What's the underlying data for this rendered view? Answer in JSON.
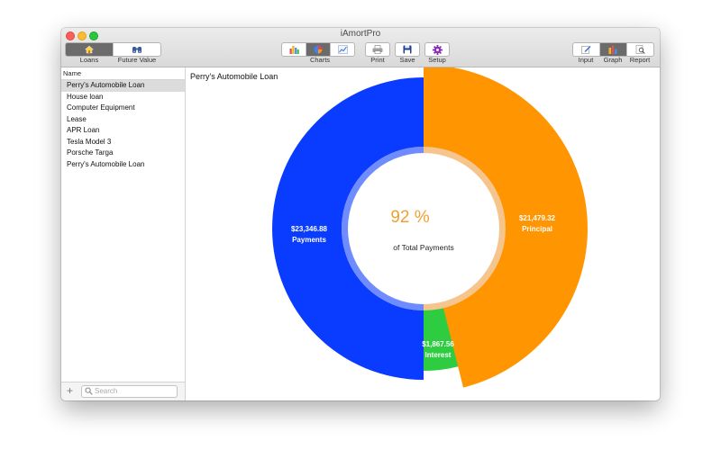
{
  "window": {
    "title": "iAmortPro"
  },
  "toolbar": {
    "nav": {
      "loans_label": "Loans",
      "future_value_label": "Future Value",
      "selected": "Loans"
    },
    "charts_label": "Charts",
    "print_label": "Print",
    "save_label": "Save",
    "setup_label": "Setup",
    "view": {
      "input_label": "Input",
      "graph_label": "Graph",
      "report_label": "Report",
      "selected": "Graph"
    }
  },
  "sidebar": {
    "column_header": "Name",
    "items": [
      "Perry's Automobile Loan",
      "House loan",
      "Computer Equipment",
      "Lease",
      "APR Loan",
      "Tesla Model 3",
      "Porsche Targa",
      "Perry's Automobile Loan"
    ],
    "selected_index": 0,
    "add_label": "+",
    "search_placeholder": "Search"
  },
  "main": {
    "title": "Perry's Automobile Loan",
    "center_percent": "92 %",
    "center_caption": "of Total Payments"
  },
  "chart_data": {
    "type": "pie",
    "title": "Perry's Automobile Loan",
    "series": [
      {
        "name": "Payments",
        "value": 23346.88,
        "label": "$23,346.88",
        "color": "#0a3cff",
        "ring": "left-half"
      },
      {
        "name": "Principal",
        "value": 21479.32,
        "label": "$21,479.32",
        "color": "#ff9500",
        "ring": "right-half"
      },
      {
        "name": "Interest",
        "value": 1867.56,
        "label": "$1,867.56",
        "color": "#2ecc40",
        "ring": "right-half"
      }
    ],
    "center_label": "92 %",
    "center_caption": "of Total Payments",
    "center_color": "#f0a030",
    "inner_ring_color": "#f6c58d"
  }
}
